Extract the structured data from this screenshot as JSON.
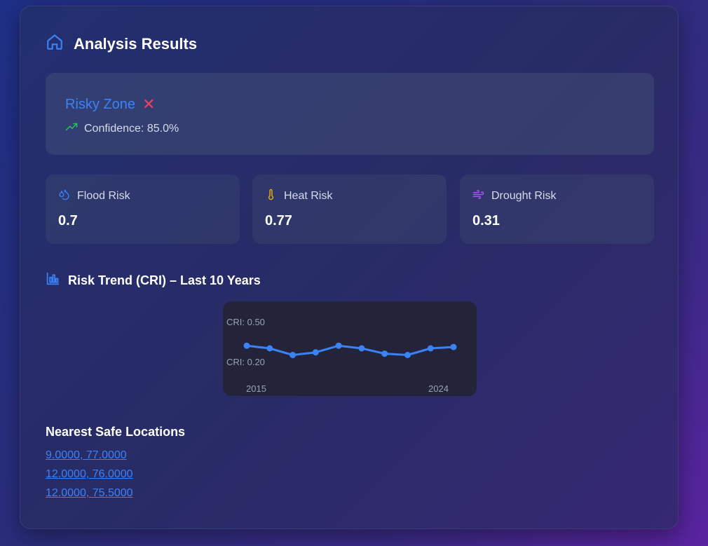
{
  "header": {
    "title": "Analysis Results",
    "icon": "home-icon"
  },
  "zone": {
    "label": "Risky Zone",
    "status_glyph": "✕",
    "confidence_text": "Confidence: 85.0%",
    "accent_color": "#3b82f6",
    "status_color": "#f43f5e",
    "trend_icon": "trending-up-icon"
  },
  "risks": [
    {
      "label": "Flood Risk",
      "value": "0.7",
      "icon": "droplets-icon",
      "color": "#3b82f6"
    },
    {
      "label": "Heat Risk",
      "value": "0.77",
      "icon": "thermometer-icon",
      "color": "#eab308"
    },
    {
      "label": "Drought Risk",
      "value": "0.31",
      "icon": "wind-icon",
      "color": "#a855f7"
    }
  ],
  "trend": {
    "title": "Risk Trend (CRI) – Last 10 Years",
    "icon": "bar-chart-icon"
  },
  "chart_data": {
    "type": "line",
    "x": [
      2015,
      2016,
      2017,
      2018,
      2019,
      2020,
      2021,
      2022,
      2023,
      2024
    ],
    "values": [
      0.32,
      0.3,
      0.25,
      0.27,
      0.32,
      0.3,
      0.26,
      0.25,
      0.3,
      0.31
    ],
    "tick_labels": {
      "y_top": "CRI: 0.50",
      "y_bottom": "CRI: 0.20",
      "x_start": "2015",
      "x_end": "2024"
    },
    "ylim": [
      0.2,
      0.5
    ],
    "line_color": "#3b82f6"
  },
  "safe": {
    "title": "Nearest Safe Locations",
    "locations": [
      "9.0000, 77.0000",
      "12.0000, 76.0000",
      "12.0000, 75.5000"
    ]
  }
}
